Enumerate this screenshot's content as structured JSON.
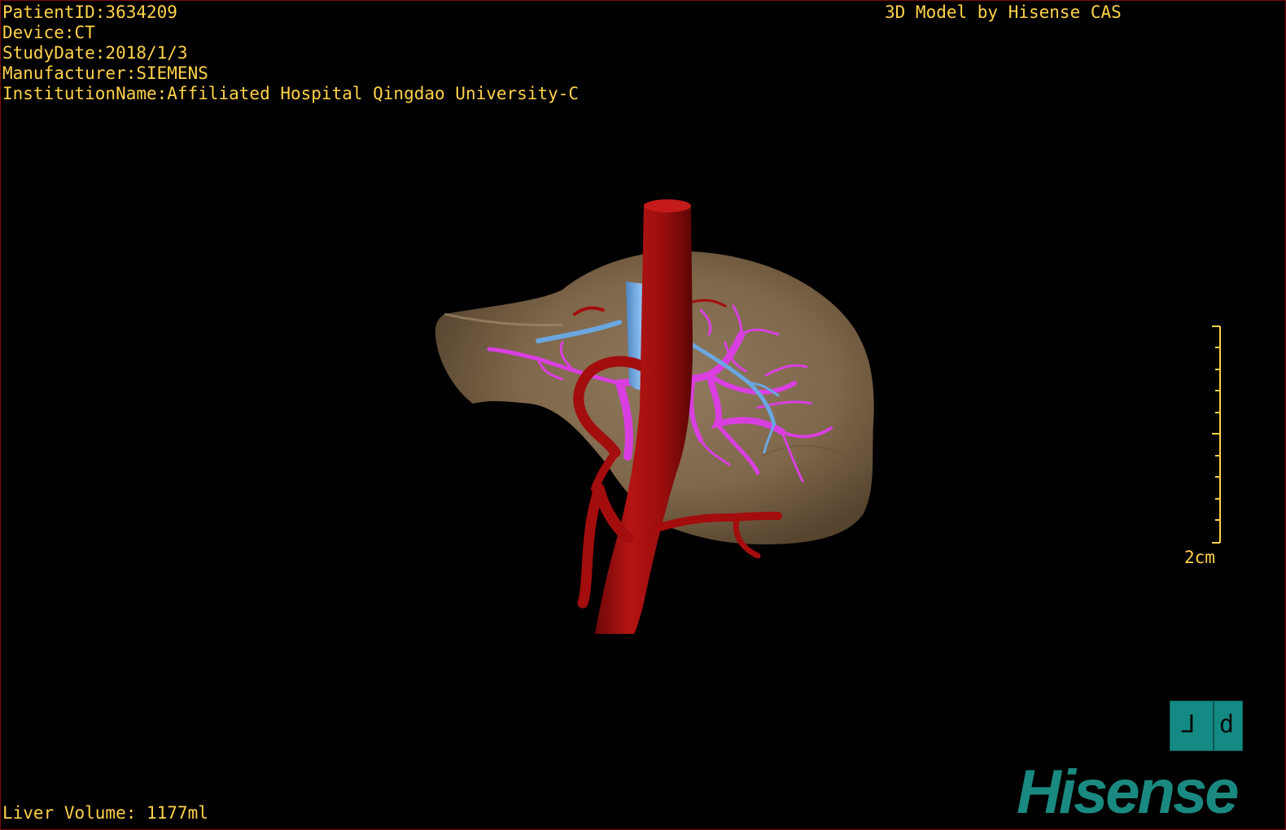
{
  "overlay": {
    "patient_id": "PatientID:3634209",
    "device": "Device:CT",
    "study_date": "StudyDate:2018/1/3",
    "manufacturer": "Manufacturer:SIEMENS",
    "institution": "InstitutionName:Affiliated Hospital Qingdao University-C",
    "model_credit": "3D Model by Hisense CAS",
    "liver_volume": "Liver Volume: 1177ml"
  },
  "scale_bar": {
    "label": "2cm"
  },
  "orientation_cube": {
    "left_face": "ᒧ",
    "right_face": "d"
  },
  "brand": {
    "name": "Hisense"
  },
  "colors": {
    "overlay_text": "#ffd24a",
    "liver": "#8b7355",
    "artery": "#a30d0d",
    "portal_vein": "#d93fe0",
    "hepatic_vein": "#6aa7e0",
    "brand_teal": "#1a8a80"
  },
  "icons": {
    "orientation": "orientation-cube-icon",
    "brand": "hisense-logo-icon"
  }
}
